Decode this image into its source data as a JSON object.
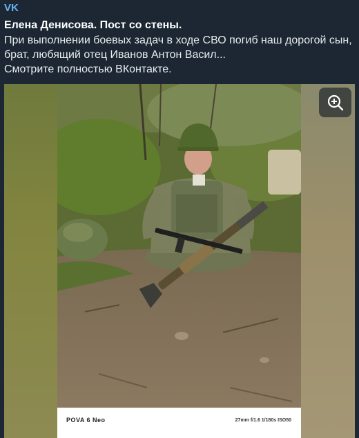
{
  "post": {
    "source": "VK",
    "title": "Елена Денисова. Пост со стены.",
    "text": "При выполнении  боевых задач в ходе СВО погиб наш дорогой сын, брат, любящий отец Иванов Антон Васил...\nСмотрите полностью ВКонтакте."
  },
  "photo": {
    "camera_model": "POVA 6 Neo",
    "camera_settings": "27mm f/1.6 1/180s ISO50"
  },
  "icons": {
    "zoom": "zoom-in-icon"
  },
  "colors": {
    "background": "#1c2733",
    "source_link": "#6ab3f3"
  }
}
